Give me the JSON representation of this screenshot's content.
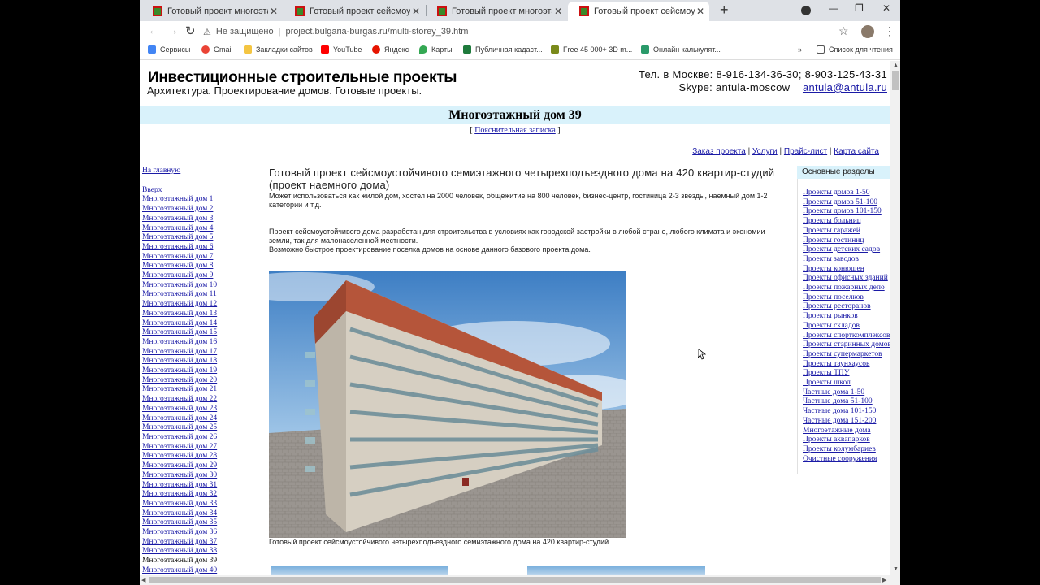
{
  "browser": {
    "tabs": [
      {
        "title": "Готовый проект многоэтажного"
      },
      {
        "title": "Готовый проект сейсмоустойчив"
      },
      {
        "title": "Готовый проект многоэтажного"
      },
      {
        "title": "Готовый проект сейсмоустойчив",
        "active": true
      }
    ],
    "address": {
      "security": "Не защищено",
      "url": "project.bulgaria-burgas.ru/multi-storey_39.htm"
    },
    "bookmarks": [
      {
        "label": "Сервисы",
        "icon": "apps-grid-icon",
        "color": "#4285f4"
      },
      {
        "label": "Gmail",
        "icon": "google-icon",
        "color": "#ea4335"
      },
      {
        "label": "Закладки сайтов",
        "icon": "folder-icon",
        "color": "#f4c542"
      },
      {
        "label": "YouTube",
        "icon": "youtube-icon",
        "color": "#ff0000"
      },
      {
        "label": "Яндекс",
        "icon": "yandex-icon",
        "color": "#e61400"
      },
      {
        "label": "Карты",
        "icon": "maps-pin-icon",
        "color": "#34a853"
      },
      {
        "label": "Публичная кадаст...",
        "icon": "cadastre-icon",
        "color": "#1e7a3c"
      },
      {
        "label": "Free 45 000+ 3D m...",
        "icon": "model-icon",
        "color": "#7a8a1a"
      },
      {
        "label": "Онлайн калькулят...",
        "icon": "calculator-icon",
        "color": "#2a9a6a"
      }
    ],
    "more_bookmarks": "»",
    "reading_list": "Список для чтения"
  },
  "header": {
    "title": "Инвестиционные строительные проекты",
    "subtitle": "Архитектура. Проектирование домов. Готовые проекты.",
    "phone_line": "Тел. в Москве: 8-916-134-36-30; 8-903-125-43-31",
    "skype": "Skype: antula-moscow",
    "email": "antula@antula.ru"
  },
  "page_title": "Многоэтажный дом 39",
  "note_link": "Пояснительная записка",
  "top_nav": [
    "Заказ проекта",
    "Услуги",
    "Прайс-лист",
    "Карта сайта"
  ],
  "left_nav": {
    "home": "На главную",
    "up": "Вверх",
    "items": [
      "Многоэтажный дом 1",
      "Многоэтажный дом 2",
      "Многоэтажный дом 3",
      "Многоэтажный дом 4",
      "Многоэтажный дом 5",
      "Многоэтажный дом 6",
      "Многоэтажный дом 7",
      "Многоэтажный дом 8",
      "Многоэтажный дом 9",
      "Многоэтажный дом 10",
      "Многоэтажный дом 11",
      "Многоэтажный дом 12",
      "Многоэтажный дом 13",
      "Многоэтажный дом 14",
      "Многоэтажный дом 15",
      "Многоэтажный дом 16",
      "Многоэтажный дом 17",
      "Многоэтажный дом 18",
      "Многоэтажный дом 19",
      "Многоэтажный дом 20",
      "Многоэтажный дом 21",
      "Многоэтажный дом 22",
      "Многоэтажный дом 23",
      "Многоэтажный дом 24",
      "Многоэтажный дом 25",
      "Многоэтажный дом 26",
      "Многоэтажный дом 27",
      "Многоэтажный дом 28",
      "Многоэтажный дом 29",
      "Многоэтажный дом 30",
      "Многоэтажный дом 31",
      "Многоэтажный дом 32",
      "Многоэтажный дом 33",
      "Многоэтажный дом 34",
      "Многоэтажный дом 35",
      "Многоэтажный дом 36",
      "Многоэтажный дом 37",
      "Многоэтажный дом 38"
    ],
    "current": "Многоэтажный дом 39",
    "next": "Многоэтажный дом 40"
  },
  "main": {
    "heading": "Готовый проект сейсмоустойчивого семиэтажного четырехподъездного дома на 420 квартир-студий (проект наемного дома)",
    "intro": "Может использоваться как жилой дом, хостел на 2000 человек, общежитие на 800 человек, бизнес-центр, гостиница 2-3 звезды, наемный дом 1-2 категории и т.д.",
    "desc1": "Проект сейсмоустойчивого дома разработан для строительства в условиях как городской застройки в любой стране, любого климата и экономии земли, так для малонаселенной местности.",
    "desc2": "Возможно быстрое проектирование поселка домов на основе данного базового проекта дома.",
    "caption": "Готовый проект сейсмоустойчивого четырехподъездного семиэтажного дома на 420 квартир-студий"
  },
  "right_nav": {
    "header": "Основные разделы",
    "items": [
      "Проекты домов 1-50",
      "Проекты домов 51-100",
      "Проекты домов 101-150",
      "Проекты больниц",
      "Проекты гаражей",
      "Проекты гостиниц",
      "Проекты детских садов",
      "Проекты заводов",
      "Проекты конюшен",
      "Проекты офисных зданий",
      "Проекты пожарных депо",
      "Проекты поселков",
      "Проекты ресторанов",
      "Проекты рынков",
      "Проекты складов",
      "Проекты спорткомплексов",
      "Проекты старинных домов",
      "Проекты супермаркетов",
      "Проекты таунхаусов",
      "Проекты ТПУ",
      "Проекты школ",
      "Частные дома 1-50",
      "Частные дома 51-100",
      "Частные дома 101-150",
      "Частные дома 151-200",
      "Многоэтажные дома",
      "Проекты аквапарков",
      "Проекты колумбариев",
      "Очистные сооружения"
    ]
  }
}
